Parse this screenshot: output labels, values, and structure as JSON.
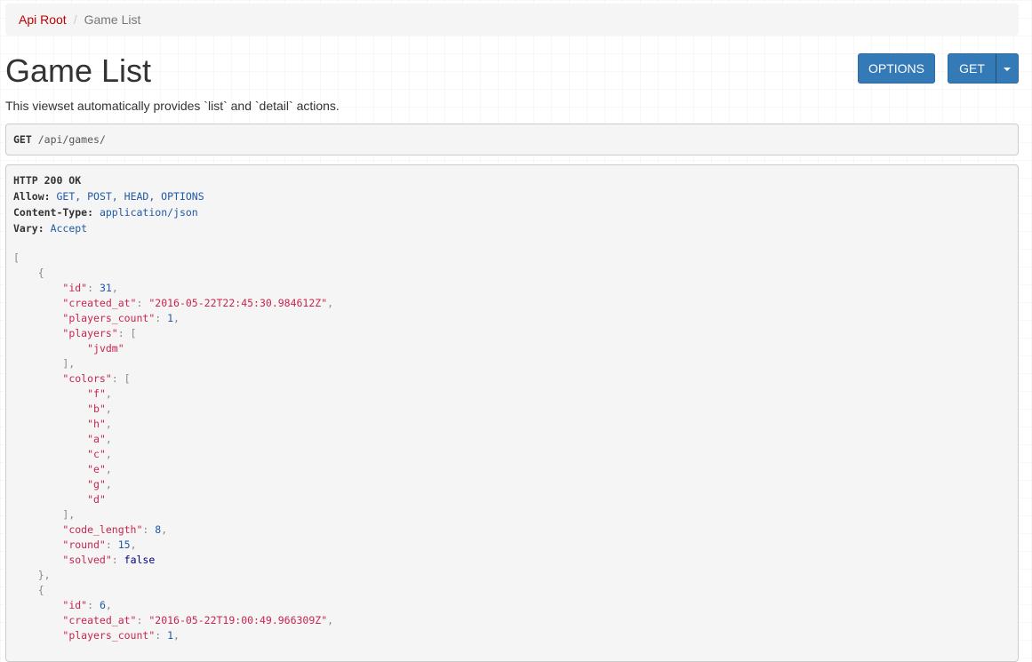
{
  "breadcrumb": {
    "root": "Api Root",
    "separator": "/",
    "current": "Game List"
  },
  "page": {
    "title": "Game List",
    "description": "This viewset automatically provides `list` and `detail` actions."
  },
  "buttons": {
    "options": "OPTIONS",
    "get": "GET"
  },
  "request": {
    "method": "GET",
    "path": "/api/games/"
  },
  "response": {
    "status": "HTTP 200 OK",
    "headers": [
      {
        "key": "Allow:",
        "value": "GET, POST, HEAD, OPTIONS"
      },
      {
        "key": "Content-Type:",
        "value": "application/json"
      },
      {
        "key": "Vary:",
        "value": "Accept"
      }
    ],
    "json_lines": [
      [
        [
          "p",
          "["
        ]
      ],
      [
        [
          "p",
          "    {"
        ]
      ],
      [
        [
          "p",
          "        "
        ],
        [
          "k",
          "\"id\""
        ],
        [
          "p",
          ": "
        ],
        [
          "n",
          "31"
        ],
        [
          "p",
          ","
        ]
      ],
      [
        [
          "p",
          "        "
        ],
        [
          "k",
          "\"created_at\""
        ],
        [
          "p",
          ": "
        ],
        [
          "s",
          "\"2016-05-22T22:45:30.984612Z\""
        ],
        [
          "p",
          ","
        ]
      ],
      [
        [
          "p",
          "        "
        ],
        [
          "k",
          "\"players_count\""
        ],
        [
          "p",
          ": "
        ],
        [
          "n",
          "1"
        ],
        [
          "p",
          ","
        ]
      ],
      [
        [
          "p",
          "        "
        ],
        [
          "k",
          "\"players\""
        ],
        [
          "p",
          ": ["
        ]
      ],
      [
        [
          "p",
          "            "
        ],
        [
          "s",
          "\"jvdm\""
        ]
      ],
      [
        [
          "p",
          "        ],"
        ]
      ],
      [
        [
          "p",
          "        "
        ],
        [
          "k",
          "\"colors\""
        ],
        [
          "p",
          ": ["
        ]
      ],
      [
        [
          "p",
          "            "
        ],
        [
          "s",
          "\"f\""
        ],
        [
          "p",
          ","
        ]
      ],
      [
        [
          "p",
          "            "
        ],
        [
          "s",
          "\"b\""
        ],
        [
          "p",
          ","
        ]
      ],
      [
        [
          "p",
          "            "
        ],
        [
          "s",
          "\"h\""
        ],
        [
          "p",
          ","
        ]
      ],
      [
        [
          "p",
          "            "
        ],
        [
          "s",
          "\"a\""
        ],
        [
          "p",
          ","
        ]
      ],
      [
        [
          "p",
          "            "
        ],
        [
          "s",
          "\"c\""
        ],
        [
          "p",
          ","
        ]
      ],
      [
        [
          "p",
          "            "
        ],
        [
          "s",
          "\"e\""
        ],
        [
          "p",
          ","
        ]
      ],
      [
        [
          "p",
          "            "
        ],
        [
          "s",
          "\"g\""
        ],
        [
          "p",
          ","
        ]
      ],
      [
        [
          "p",
          "            "
        ],
        [
          "s",
          "\"d\""
        ]
      ],
      [
        [
          "p",
          "        ],"
        ]
      ],
      [
        [
          "p",
          "        "
        ],
        [
          "k",
          "\"code_length\""
        ],
        [
          "p",
          ": "
        ],
        [
          "n",
          "8"
        ],
        [
          "p",
          ","
        ]
      ],
      [
        [
          "p",
          "        "
        ],
        [
          "k",
          "\"round\""
        ],
        [
          "p",
          ": "
        ],
        [
          "n",
          "15"
        ],
        [
          "p",
          ","
        ]
      ],
      [
        [
          "p",
          "        "
        ],
        [
          "k",
          "\"solved\""
        ],
        [
          "p",
          ": "
        ],
        [
          "lit",
          "false"
        ]
      ],
      [
        [
          "p",
          "    },"
        ]
      ],
      [
        [
          "p",
          "    {"
        ]
      ],
      [
        [
          "p",
          "        "
        ],
        [
          "k",
          "\"id\""
        ],
        [
          "p",
          ": "
        ],
        [
          "n",
          "6"
        ],
        [
          "p",
          ","
        ]
      ],
      [
        [
          "p",
          "        "
        ],
        [
          "k",
          "\"created_at\""
        ],
        [
          "p",
          ": "
        ],
        [
          "s",
          "\"2016-05-22T19:00:49.966309Z\""
        ],
        [
          "p",
          ","
        ]
      ],
      [
        [
          "p",
          "        "
        ],
        [
          "k",
          "\"players_count\""
        ],
        [
          "p",
          ": "
        ],
        [
          "n",
          "1"
        ],
        [
          "p",
          ","
        ]
      ]
    ]
  }
}
